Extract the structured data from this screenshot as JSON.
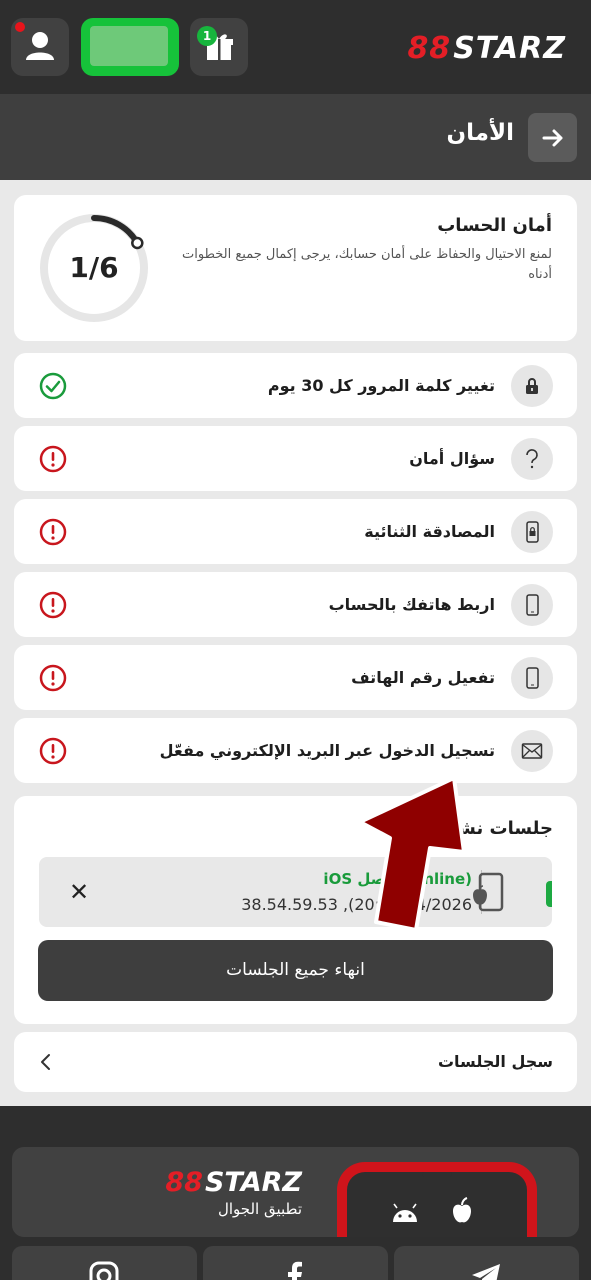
{
  "header": {
    "logo_mark": "88",
    "logo_text": "STARZ",
    "gift_badge": "1"
  },
  "page": {
    "title": "الأمان"
  },
  "security": {
    "title": "أمان الحساب",
    "description": "لمنع الاحتيال والحفاظ على أمان حسابك، يرجى إكمال جميع الخطوات أدناه",
    "progress_text": "1/6",
    "progress_fraction": 0.1667
  },
  "items": [
    {
      "label": "تغيير كلمة المرور كل 30 يوم",
      "icon": "lock-icon",
      "status": "done"
    },
    {
      "label": "سؤال أمان",
      "icon": "question-icon",
      "status": "warning"
    },
    {
      "label": "المصادقة الثنائية",
      "icon": "phone-lock-icon",
      "status": "warning"
    },
    {
      "label": "اربط هاتفك بالحساب",
      "icon": "phone-icon",
      "status": "warning"
    },
    {
      "label": "تفعيل رقم الهاتف",
      "icon": "phone-icon",
      "status": "warning"
    },
    {
      "label": "تسجيل الدخول عبر البريد الإلكتروني مفعّل",
      "icon": "mail-icon",
      "status": "warning"
    }
  ],
  "sessions": {
    "title": "جلسات نشطة",
    "row": {
      "status": "iOS متصل (online)",
      "meta": "38.54.59.53 ,(20:33 04/2026"
    },
    "end_all_label": "انهاء جميع الجلسات"
  },
  "history": {
    "label": "سجل الجلسات"
  },
  "footer": {
    "logo_mark": "88",
    "logo_text": "STARZ",
    "app_label": "تطبيق الجوال"
  },
  "colors": {
    "success": "#1a9b3c",
    "warning": "#c8161d",
    "brand_red": "#e41e26",
    "balance_green": "#16c23a",
    "arrow_red": "#8f0000"
  }
}
